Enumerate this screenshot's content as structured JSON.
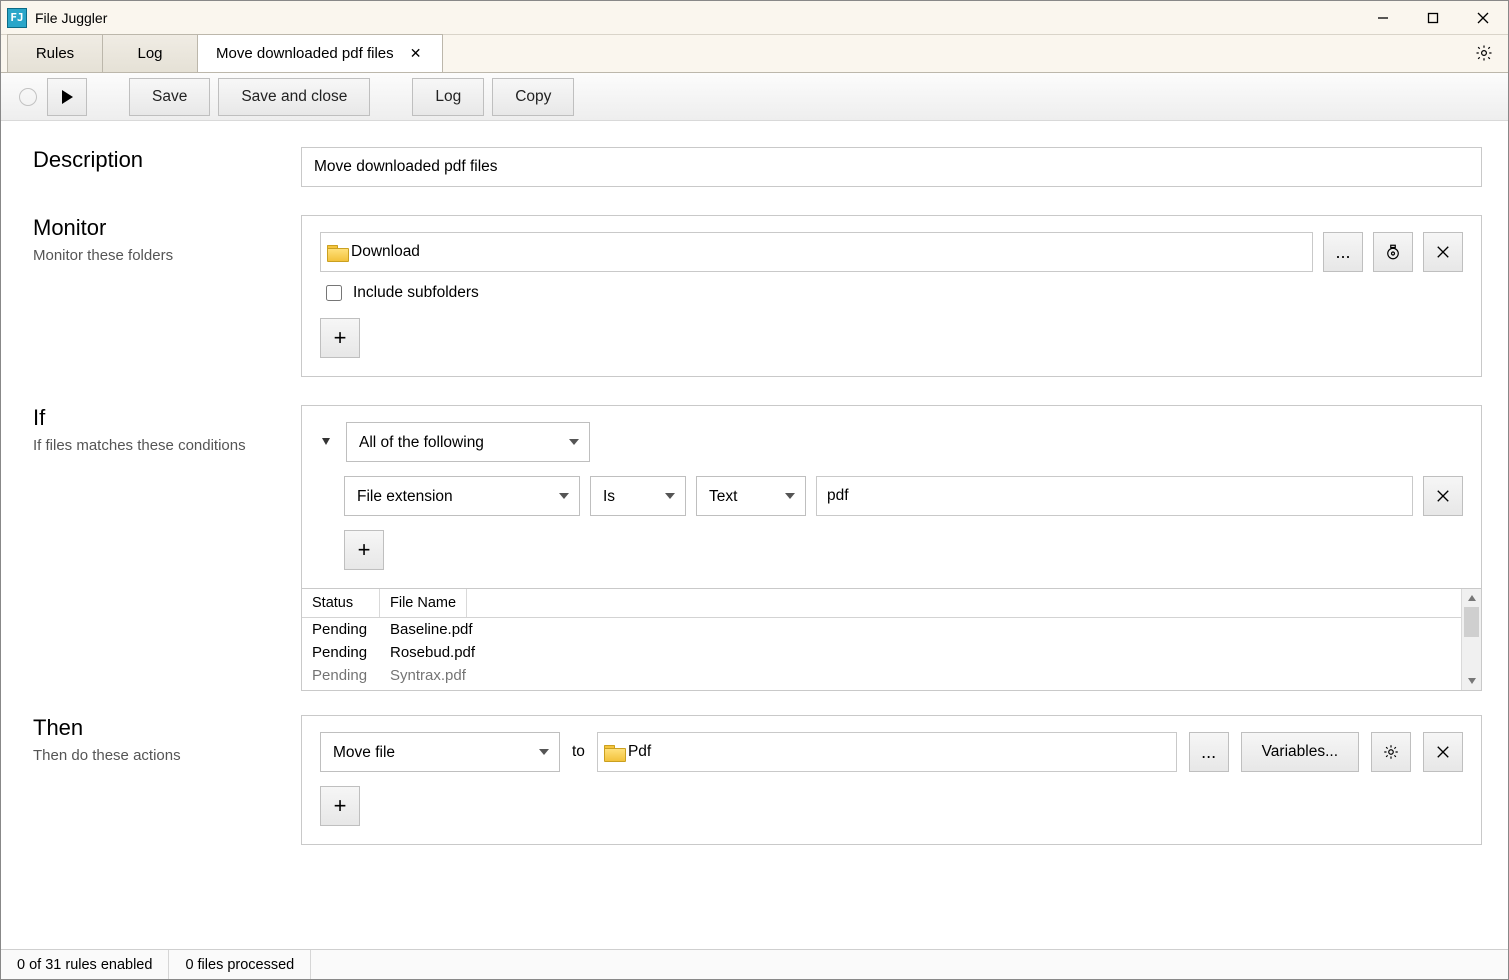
{
  "window": {
    "title": "File Juggler"
  },
  "tabs": {
    "rules": "Rules",
    "log": "Log",
    "current": "Move downloaded pdf files"
  },
  "toolbar": {
    "save": "Save",
    "save_close": "Save and close",
    "log": "Log",
    "copy": "Copy"
  },
  "description": {
    "heading": "Description",
    "value": "Move downloaded pdf files"
  },
  "monitor": {
    "heading": "Monitor",
    "sub": "Monitor these folders",
    "folder": "Download",
    "include_subfolders_label": "Include subfolders",
    "include_subfolders_checked": false,
    "browse": "...",
    "timer_tooltip": "timer",
    "remove_tooltip": "remove"
  },
  "if": {
    "heading": "If",
    "sub": "If files matches these conditions",
    "group": "All of the following",
    "cond": {
      "field": "File extension",
      "op": "Is",
      "type": "Text",
      "value": "pdf"
    }
  },
  "filelist": {
    "headers": {
      "status": "Status",
      "name": "File Name"
    },
    "rows": [
      {
        "status": "Pending",
        "name": "Baseline.pdf"
      },
      {
        "status": "Pending",
        "name": "Rosebud.pdf"
      },
      {
        "status": "Pending",
        "name": "Syntrax.pdf"
      }
    ]
  },
  "then": {
    "heading": "Then",
    "sub": "Then do these actions",
    "action": "Move file",
    "to_label": "to",
    "dest": "Pdf",
    "browse": "...",
    "variables": "Variables...",
    "settings_tooltip": "settings"
  },
  "status": {
    "rules": "0 of 31 rules enabled",
    "files": "0 files processed"
  }
}
